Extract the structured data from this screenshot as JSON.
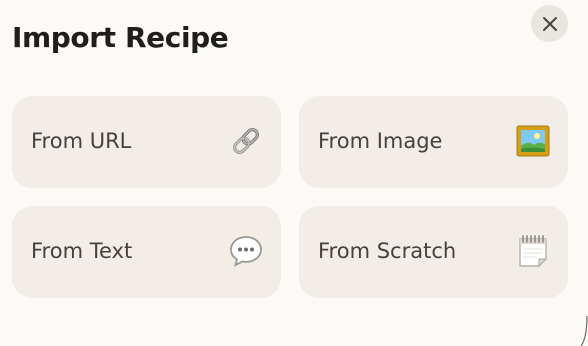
{
  "dialog": {
    "title": "Import Recipe",
    "close_icon": "close-x-icon"
  },
  "options": [
    {
      "label": "From URL",
      "icon": "link-icon"
    },
    {
      "label": "From Image",
      "icon": "framed-picture-icon"
    },
    {
      "label": "From Text",
      "icon": "speech-bubble-icon"
    },
    {
      "label": "From Scratch",
      "icon": "notepad-icon"
    }
  ],
  "colors": {
    "background": "#fbfaf6",
    "card": "#f2eee7",
    "close_button": "#e9e6df",
    "title_text": "#1f1e1c",
    "label_text": "#46423b"
  }
}
